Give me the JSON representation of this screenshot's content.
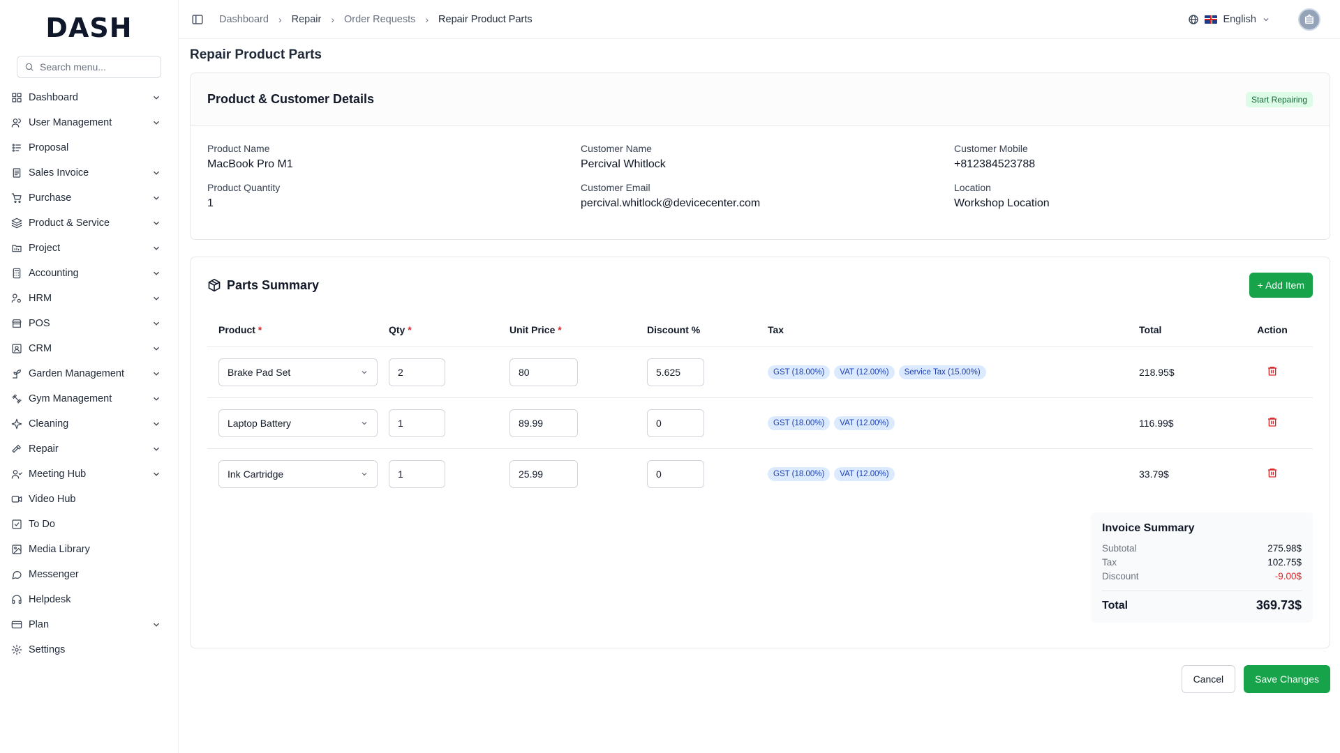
{
  "brand": {
    "logo_text_pre": "D",
    "logo_text_post": "ASH",
    "accent": "#16a34a"
  },
  "search": {
    "placeholder": "Search menu..."
  },
  "sidebar": {
    "items": [
      {
        "label": "Dashboard",
        "icon": "grid-icon",
        "has_children": true
      },
      {
        "label": "User Management",
        "icon": "users-icon",
        "has_children": true
      },
      {
        "label": "Proposal",
        "icon": "proposal-icon",
        "has_children": false
      },
      {
        "label": "Sales Invoice",
        "icon": "invoice-icon",
        "has_children": true
      },
      {
        "label": "Purchase",
        "icon": "cart-icon",
        "has_children": true
      },
      {
        "label": "Product & Service",
        "icon": "layers-icon",
        "has_children": true
      },
      {
        "label": "Project",
        "icon": "folder-icon",
        "has_children": true
      },
      {
        "label": "Accounting",
        "icon": "calculator-icon",
        "has_children": true
      },
      {
        "label": "HRM",
        "icon": "hrm-icon",
        "has_children": true
      },
      {
        "label": "POS",
        "icon": "store-icon",
        "has_children": true
      },
      {
        "label": "CRM",
        "icon": "crm-icon",
        "has_children": true
      },
      {
        "label": "Garden Management",
        "icon": "sprout-icon",
        "has_children": true
      },
      {
        "label": "Gym Management",
        "icon": "dumbbell-icon",
        "has_children": true
      },
      {
        "label": "Cleaning",
        "icon": "sparkle-icon",
        "has_children": true
      },
      {
        "label": "Repair",
        "icon": "hammer-icon",
        "has_children": true
      },
      {
        "label": "Meeting Hub",
        "icon": "meeting-icon",
        "has_children": true
      },
      {
        "label": "Video Hub",
        "icon": "video-icon",
        "has_children": false
      },
      {
        "label": "To Do",
        "icon": "checkbox-icon",
        "has_children": false
      },
      {
        "label": "Media Library",
        "icon": "image-icon",
        "has_children": false
      },
      {
        "label": "Messenger",
        "icon": "chat-icon",
        "has_children": false
      },
      {
        "label": "Helpdesk",
        "icon": "headset-icon",
        "has_children": false
      },
      {
        "label": "Plan",
        "icon": "card-icon",
        "has_children": true
      },
      {
        "label": "Settings",
        "icon": "gear-icon",
        "has_children": false
      }
    ]
  },
  "breadcrumb": {
    "items": [
      "Dashboard",
      "Repair",
      "Order Requests",
      "Repair Product Parts"
    ]
  },
  "topbar": {
    "language": "English"
  },
  "page": {
    "title": "Repair Product Parts"
  },
  "details_card": {
    "title": "Product & Customer Details",
    "status": "Start Repairing",
    "fields": [
      {
        "label": "Product Name",
        "value": "MacBook Pro M1"
      },
      {
        "label": "Customer Name",
        "value": "Percival Whitlock"
      },
      {
        "label": "Customer Mobile",
        "value": "+812384523788"
      },
      {
        "label": "Product Quantity",
        "value": "1"
      },
      {
        "label": "Customer Email",
        "value": "percival.whitlock@devicecenter.com"
      },
      {
        "label": "Location",
        "value": "Workshop Location"
      }
    ]
  },
  "parts": {
    "title": "Parts Summary",
    "add_label": "+ Add Item",
    "columns": {
      "product": "Product",
      "qty": "Qty",
      "unit_price": "Unit Price",
      "discount": "Discount %",
      "tax": "Tax",
      "total": "Total",
      "action": "Action"
    },
    "rows": [
      {
        "product": "Brake Pad Set",
        "qty": "2",
        "unit_price": "80",
        "discount": "5.625",
        "taxes": [
          "GST (18.00%)",
          "VAT (12.00%)",
          "Service Tax (15.00%)"
        ],
        "total": "218.95$"
      },
      {
        "product": "Laptop Battery",
        "qty": "1",
        "unit_price": "89.99",
        "discount": "0",
        "taxes": [
          "GST (18.00%)",
          "VAT (12.00%)"
        ],
        "total": "116.99$"
      },
      {
        "product": "Ink Cartridge",
        "qty": "1",
        "unit_price": "25.99",
        "discount": "0",
        "taxes": [
          "GST (18.00%)",
          "VAT (12.00%)"
        ],
        "total": "33.79$"
      }
    ]
  },
  "invoice_summary": {
    "title": "Invoice Summary",
    "subtotal_label": "Subtotal",
    "subtotal": "275.98$",
    "tax_label": "Tax",
    "tax": "102.75$",
    "discount_label": "Discount",
    "discount": "-9.00$",
    "total_label": "Total",
    "total": "369.73$"
  },
  "footer_actions": {
    "cancel": "Cancel",
    "save": "Save Changes"
  },
  "colors": {
    "primary": "#16a34a",
    "danger": "#dc2626",
    "pill_bg": "#dbeafe",
    "pill_text": "#1e40af"
  }
}
